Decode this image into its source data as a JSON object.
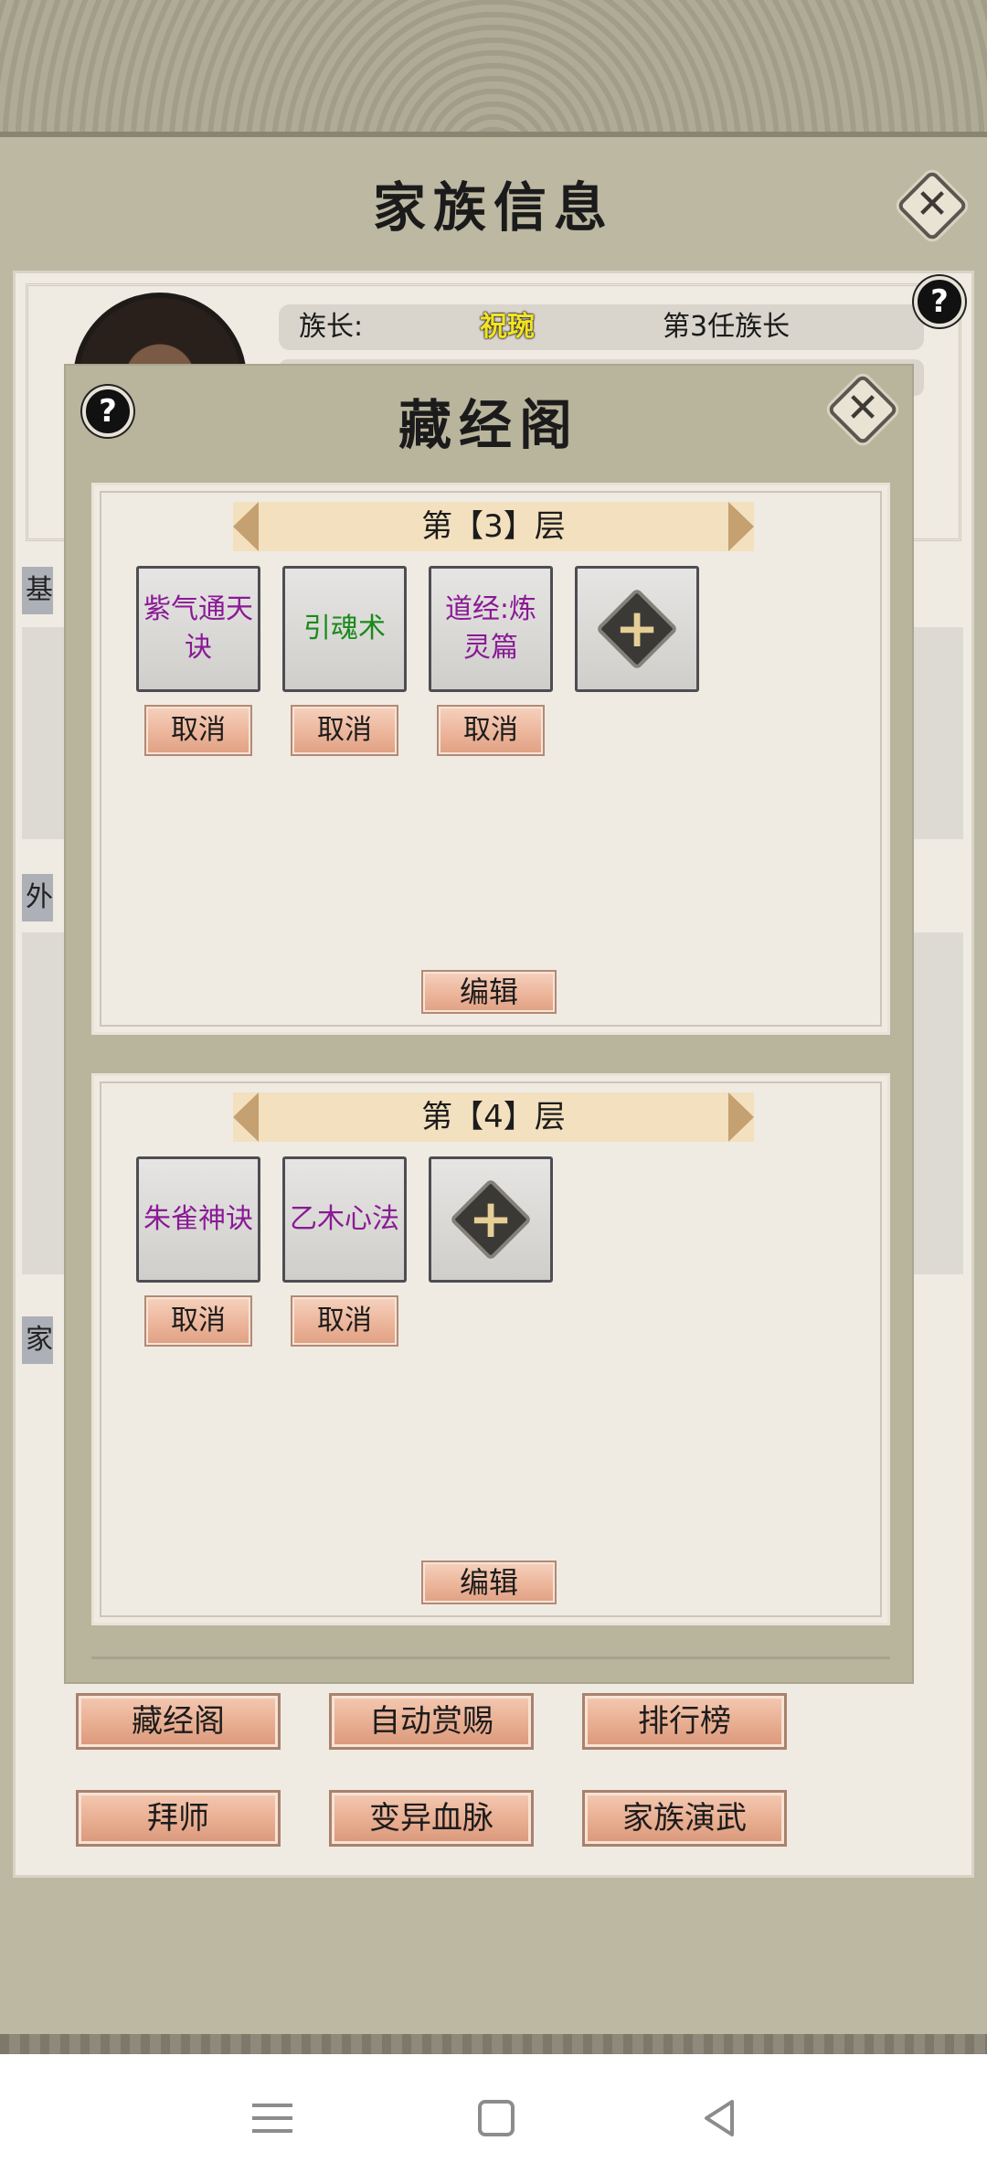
{
  "family_info": {
    "title": "家族信息",
    "leader_label": "族长:",
    "leader_name": "祝琬",
    "leader_generation": "第3任族长",
    "side_tabs": [
      "基",
      "外",
      "家"
    ],
    "buttons": [
      "藏经阁",
      "自动赏赐",
      "排行榜",
      "拜师",
      "变异血脉",
      "家族演武"
    ]
  },
  "dialog": {
    "title": "藏经阁",
    "floors": [
      {
        "header": "第【3】层",
        "slots": [
          {
            "text": "紫气通天诀",
            "color": "purple"
          },
          {
            "text": "引魂术",
            "color": "green"
          },
          {
            "text": "道经:炼灵篇",
            "color": "purple"
          }
        ],
        "cancel_label": "取消",
        "edit_label": "编辑"
      },
      {
        "header": "第【4】层",
        "slots": [
          {
            "text": "朱雀神诀",
            "color": "purple"
          },
          {
            "text": "乙木心法",
            "color": "purple"
          }
        ],
        "cancel_label": "取消",
        "edit_label": "编辑"
      }
    ]
  },
  "icons": {
    "close": "close-icon",
    "help": "help-icon",
    "add": "add-icon",
    "nav_menu": "menu-icon",
    "nav_home": "home-icon",
    "nav_back": "back-icon"
  },
  "colors": {
    "purple_text": "#8a1a95",
    "green_text": "#1a8a1a",
    "leader_name": "#f3e322"
  }
}
